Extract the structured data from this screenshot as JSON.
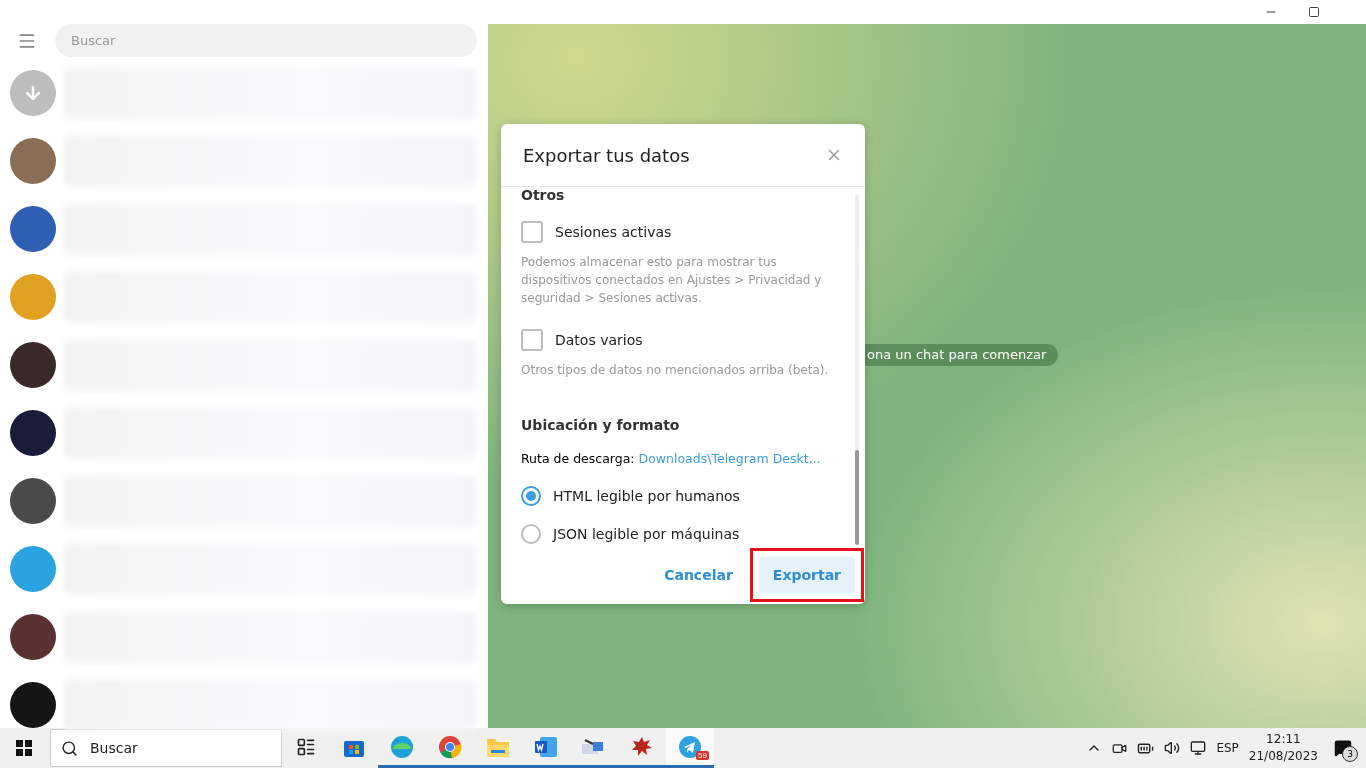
{
  "sidebar": {
    "search": {
      "placeholder": "Buscar"
    },
    "chats": [
      {
        "kind": "archive",
        "color": "#bdbdbd"
      },
      {
        "kind": "photo",
        "color": "#8a6d55"
      },
      {
        "kind": "photo",
        "color": "#2f5fb3"
      },
      {
        "kind": "photo",
        "color": "#e0a020"
      },
      {
        "kind": "photo",
        "color": "#3a2a2a"
      },
      {
        "kind": "photo",
        "color": "#1b1b3a"
      },
      {
        "kind": "photo",
        "color": "#4a4a4a"
      },
      {
        "kind": "photo",
        "color": "#2aa3e0"
      },
      {
        "kind": "photo",
        "color": "#5a3030"
      },
      {
        "kind": "photo",
        "color": "#151515"
      }
    ]
  },
  "chat_area": {
    "hint": "ona un chat para comenzar"
  },
  "dialog": {
    "title": "Exportar tus datos",
    "section": "Otros",
    "options": [
      {
        "label": "Sesiones activas",
        "checked": false,
        "description": "Podemos almacenar esto para mostrar tus dispositivos conectados en Ajustes > Privacidad y seguridad > Sesiones activas."
      },
      {
        "label": "Datos varios",
        "checked": false,
        "description": "Otros tipos de datos no mencionados arriba (beta)."
      }
    ],
    "location_title": "Ubicación y formato",
    "path_label": "Ruta de descarga:",
    "path": "Downloads\\Telegram Deskt...",
    "formats": [
      {
        "label": "HTML legible por humanos",
        "selected": true
      },
      {
        "label": "JSON legible por máquinas",
        "selected": false
      }
    ],
    "buttons": [
      {
        "label": "Cancelar",
        "kind": "flat",
        "highlighted": false
      },
      {
        "label": "Exportar",
        "kind": "filled",
        "highlighted": true
      }
    ]
  },
  "taskbar": {
    "search": {
      "placeholder": "Buscar"
    },
    "apps": [
      {
        "kind": "taskview",
        "running": false
      },
      {
        "kind": "store",
        "running": false
      },
      {
        "kind": "edge",
        "running": true
      },
      {
        "kind": "chrome",
        "running": true
      },
      {
        "kind": "files",
        "running": true
      },
      {
        "kind": "word",
        "running": true
      },
      {
        "kind": "tool",
        "running": true
      },
      {
        "kind": "splat",
        "running": true
      },
      {
        "kind": "telegram",
        "running": true,
        "badge": "59"
      }
    ],
    "language": "ESP",
    "time": "12:11",
    "date": "21/08/2023",
    "notifications": "3"
  }
}
